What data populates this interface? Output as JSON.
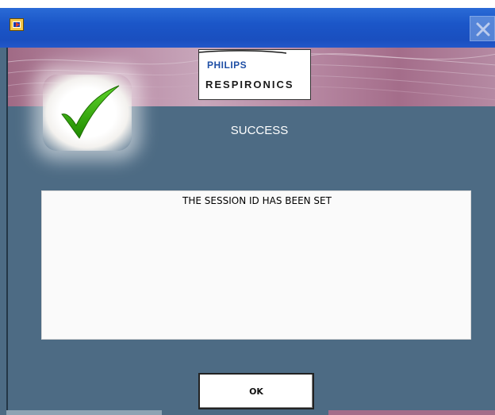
{
  "title_bar": {
    "icon": "labview-app-icon",
    "close_icon": "close-x-icon"
  },
  "banner": {
    "logo_brand": "PHILIPS",
    "logo_sub": "RESPIRONICS"
  },
  "status": {
    "icon": "green-checkmark-icon",
    "label": "SUCCESS"
  },
  "message": {
    "text": "THE SESSION ID HAS BEEN SET"
  },
  "actions": {
    "ok_label": "OK"
  },
  "colors": {
    "title_bar": "#1b56c8",
    "panel_background": "#4d6b84",
    "banner": "#b98ca6",
    "check": "#2fa300",
    "brand_blue": "#1f4fa5"
  }
}
